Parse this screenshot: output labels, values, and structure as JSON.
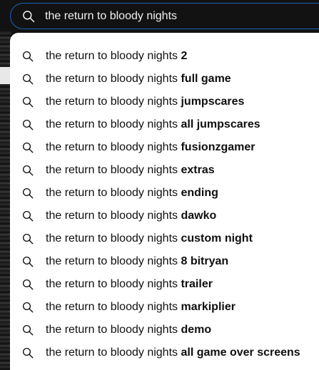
{
  "search": {
    "query": "the return to bloody nights",
    "icon": "search-icon"
  },
  "suggestions": [
    {
      "prefix": "the return to bloody nights",
      "suffix": "2"
    },
    {
      "prefix": "the return to bloody nights",
      "suffix": "full game"
    },
    {
      "prefix": "the return to bloody nights",
      "suffix": "jumpscares"
    },
    {
      "prefix": "the return to bloody nights",
      "suffix": "all jumpscares"
    },
    {
      "prefix": "the return to bloody nights",
      "suffix": "fusionzgamer"
    },
    {
      "prefix": "the return to bloody nights",
      "suffix": "extras"
    },
    {
      "prefix": "the return to bloody nights",
      "suffix": "ending"
    },
    {
      "prefix": "the return to bloody nights",
      "suffix": "dawko"
    },
    {
      "prefix": "the return to bloody nights",
      "suffix": "custom night"
    },
    {
      "prefix": "the return to bloody nights",
      "suffix": "8 bitryan"
    },
    {
      "prefix": "the return to bloody nights",
      "suffix": "trailer"
    },
    {
      "prefix": "the return to bloody nights",
      "suffix": "markiplier"
    },
    {
      "prefix": "the return to bloody nights",
      "suffix": "demo"
    },
    {
      "prefix": "the return to bloody nights",
      "suffix": "all game over screens"
    }
  ],
  "colors": {
    "accent_border": "#1c62b9",
    "bar_background": "#121212",
    "dropdown_background": "#ffffff",
    "text_dark": "#0f0f0f",
    "text_light": "#f1f1f1"
  }
}
